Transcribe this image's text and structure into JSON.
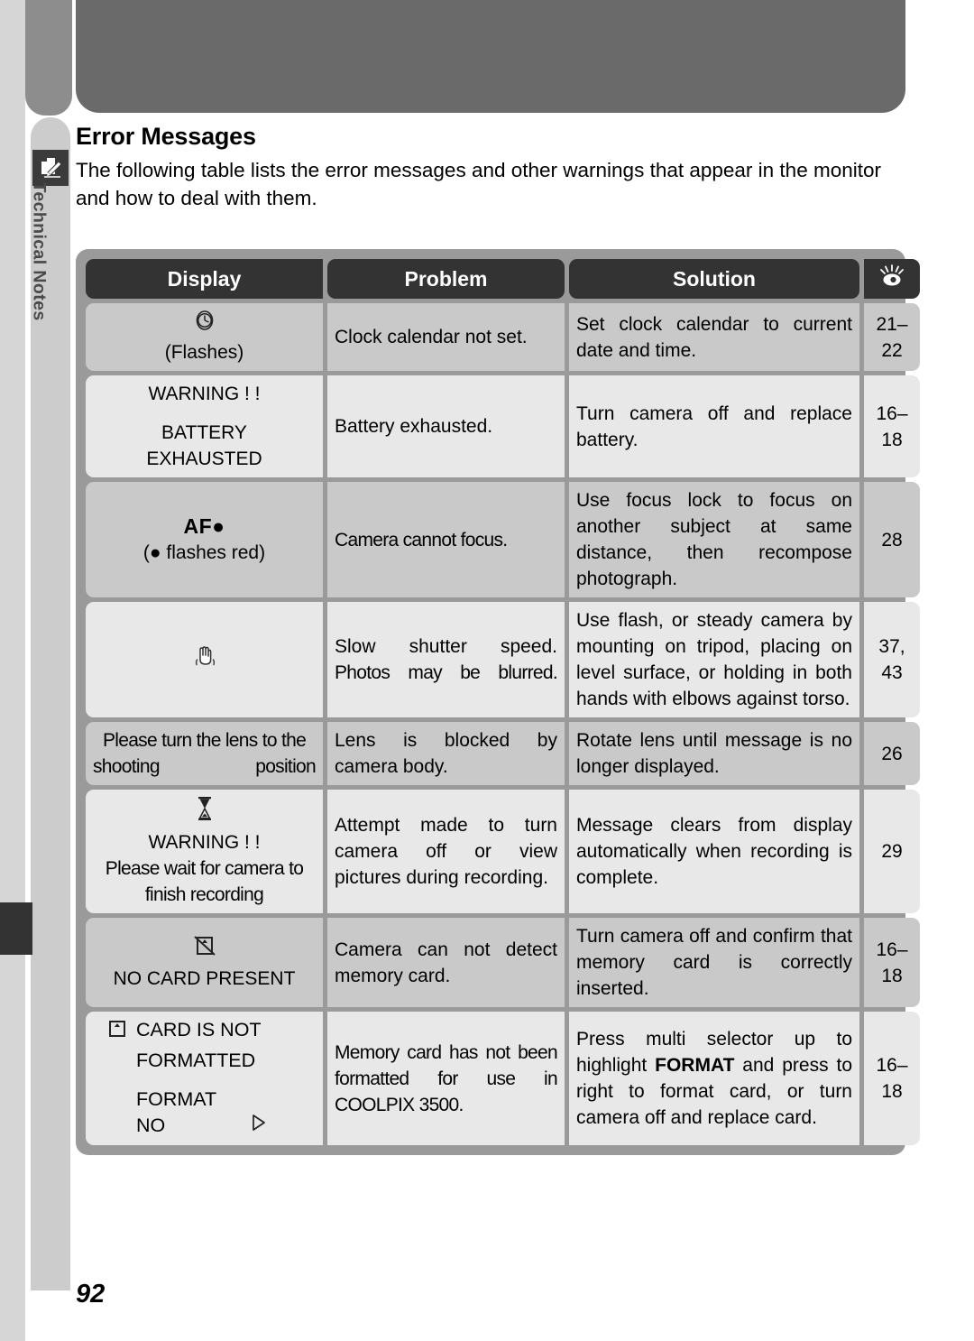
{
  "document": {
    "page_number": "92",
    "side_tab": {
      "label": "Technical Notes",
      "icon": "notes-pencil-icon"
    },
    "section": {
      "title": "Error Messages",
      "intro": "The following table lists the error messages and other warnings that appear in the monitor and how to deal with them."
    }
  },
  "table": {
    "headers": {
      "display": "Display",
      "problem": "Problem",
      "solution": "Solution",
      "page_ref_icon": "eye-reference-icon"
    },
    "rows": [
      {
        "display_icon": "clock-icon",
        "display_lines": [
          "(Flashes)"
        ],
        "problem": "Clock calendar not set.",
        "solution": "Set clock calendar to current date and time.",
        "page": "21–22"
      },
      {
        "display_icon": null,
        "display_lines": [
          "WARNING ! !",
          "BATTERY",
          "EXHAUSTED"
        ],
        "problem": "Battery exhausted.",
        "solution": "Turn camera off and replace battery.",
        "page": "16–18"
      },
      {
        "display_icon": null,
        "display_lines": [
          "AF●",
          "(● flashes red)"
        ],
        "problem": "Camera cannot focus.",
        "solution": "Use focus lock to focus on another subject at same distance, then recompose photograph.",
        "page": "28"
      },
      {
        "display_icon": "camera-shake-hand-icon",
        "display_lines": [],
        "problem": "Slow shutter speed. Photos may be blurred.",
        "solution": "Use flash, or steady camera by mounting on tripod, placing on level surface, or holding in both hands with elbows against torso.",
        "page": "37, 43"
      },
      {
        "display_icon": null,
        "display_lines": [
          "Please turn the lens to the shooting position"
        ],
        "problem": "Lens is blocked by camera body.",
        "solution": "Rotate lens until message is no longer displayed.",
        "page": "26"
      },
      {
        "display_icon": "hourglass-icon",
        "display_lines": [
          "WARNING ! !",
          "Please wait for camera to finish recording"
        ],
        "problem": "Attempt made to turn camera off or view pictures during recording.",
        "solution": "Message clears from display automatically when recording is complete.",
        "page": "29"
      },
      {
        "display_icon": "no-memory-card-icon",
        "display_lines": [
          "NO CARD PRESENT"
        ],
        "problem": "Camera can not detect memory card.",
        "solution": "Turn camera off and confirm that memory card is correctly inserted.",
        "page": "16–18"
      },
      {
        "display_icon": "memory-card-icon",
        "display_lines": [
          "CARD IS NOT",
          "FORMATTED",
          "FORMAT",
          "NO"
        ],
        "problem": "Memory card has not been formatted for use in COOLPIX 3500.",
        "solution_parts": {
          "before": "Press multi selector up to highlight ",
          "emphasis": "FORMAT",
          "after": " and press to right to format card, or turn camera off and replace card."
        },
        "page": "16–18"
      }
    ]
  },
  "row_text": {
    "r1": {
      "display_0": "(Flashes)",
      "problem": "Clock calendar not set.",
      "solution": "Set clock calendar to current date and time.",
      "page": "21–22"
    },
    "r2": {
      "display_0": "WARNING ! !",
      "display_1": "BATTERY",
      "display_2": "EXHAUSTED",
      "problem": "Battery exhausted.",
      "solution": "Turn camera off and replace battery.",
      "page": "16–18"
    },
    "r3": {
      "display_0": "AF●",
      "display_1": "(● flashes red)",
      "problem": "Camera cannot focus.",
      "solution": "Use focus lock to focus on another subject at same distance, then recompose photograph.",
      "page": "28"
    },
    "r4": {
      "problem_0": "Slow shutter speed.",
      "problem_1": "Photos may be blurred.",
      "solution": "Use flash, or steady camera by mounting on tripod, placing on level surface, or holding in both hands with elbows against torso.",
      "page_0": "37,",
      "page_1": "43"
    },
    "r5": {
      "display_0": "Please turn the lens to the shooting position",
      "problem": "Lens is blocked by camera body.",
      "solution": "Rotate lens until message is no longer displayed.",
      "page": "26"
    },
    "r6": {
      "display_0": "WARNING ! !",
      "display_1": "Please wait for camera to finish recording",
      "problem": "Attempt made to turn camera off or view pictures during recording.",
      "solution": "Message clears from display automatically when recording is complete.",
      "page": "29"
    },
    "r7": {
      "display_0": "NO CARD PRESENT",
      "problem": "Camera can not detect memory card.",
      "solution": "Turn camera off and confirm that memory card is correctly inserted.",
      "page": "16–18"
    },
    "r8": {
      "display_0": "CARD IS NOT",
      "display_1": "FORMATTED",
      "display_2": "FORMAT",
      "display_3": "NO",
      "problem": "Memory card has not been formatted for use in COOLPIX 3500.",
      "sol_before": "Press multi selector up to highlight ",
      "sol_em": "FORMAT",
      "sol_after": " and press to right to format card, or turn camera off and replace card.",
      "page": "16–18"
    }
  }
}
